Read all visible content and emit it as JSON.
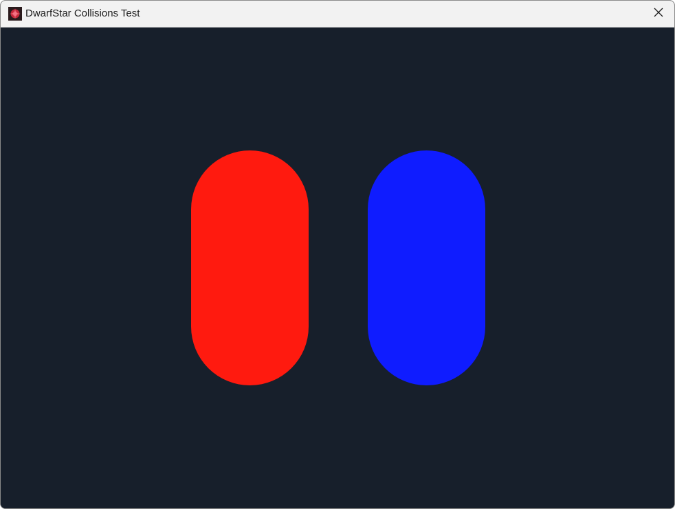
{
  "window": {
    "title": "DwarfStar Collisions Test",
    "app_icon": "dwarfstar-app-icon",
    "close_icon": "close-icon"
  },
  "scene": {
    "background_color": "#171f2b",
    "shapes": [
      {
        "name": "red-capsule",
        "shape": "capsule",
        "color": "#ff1a0f"
      },
      {
        "name": "blue-capsule",
        "shape": "capsule",
        "color": "#0f1cff"
      }
    ]
  }
}
